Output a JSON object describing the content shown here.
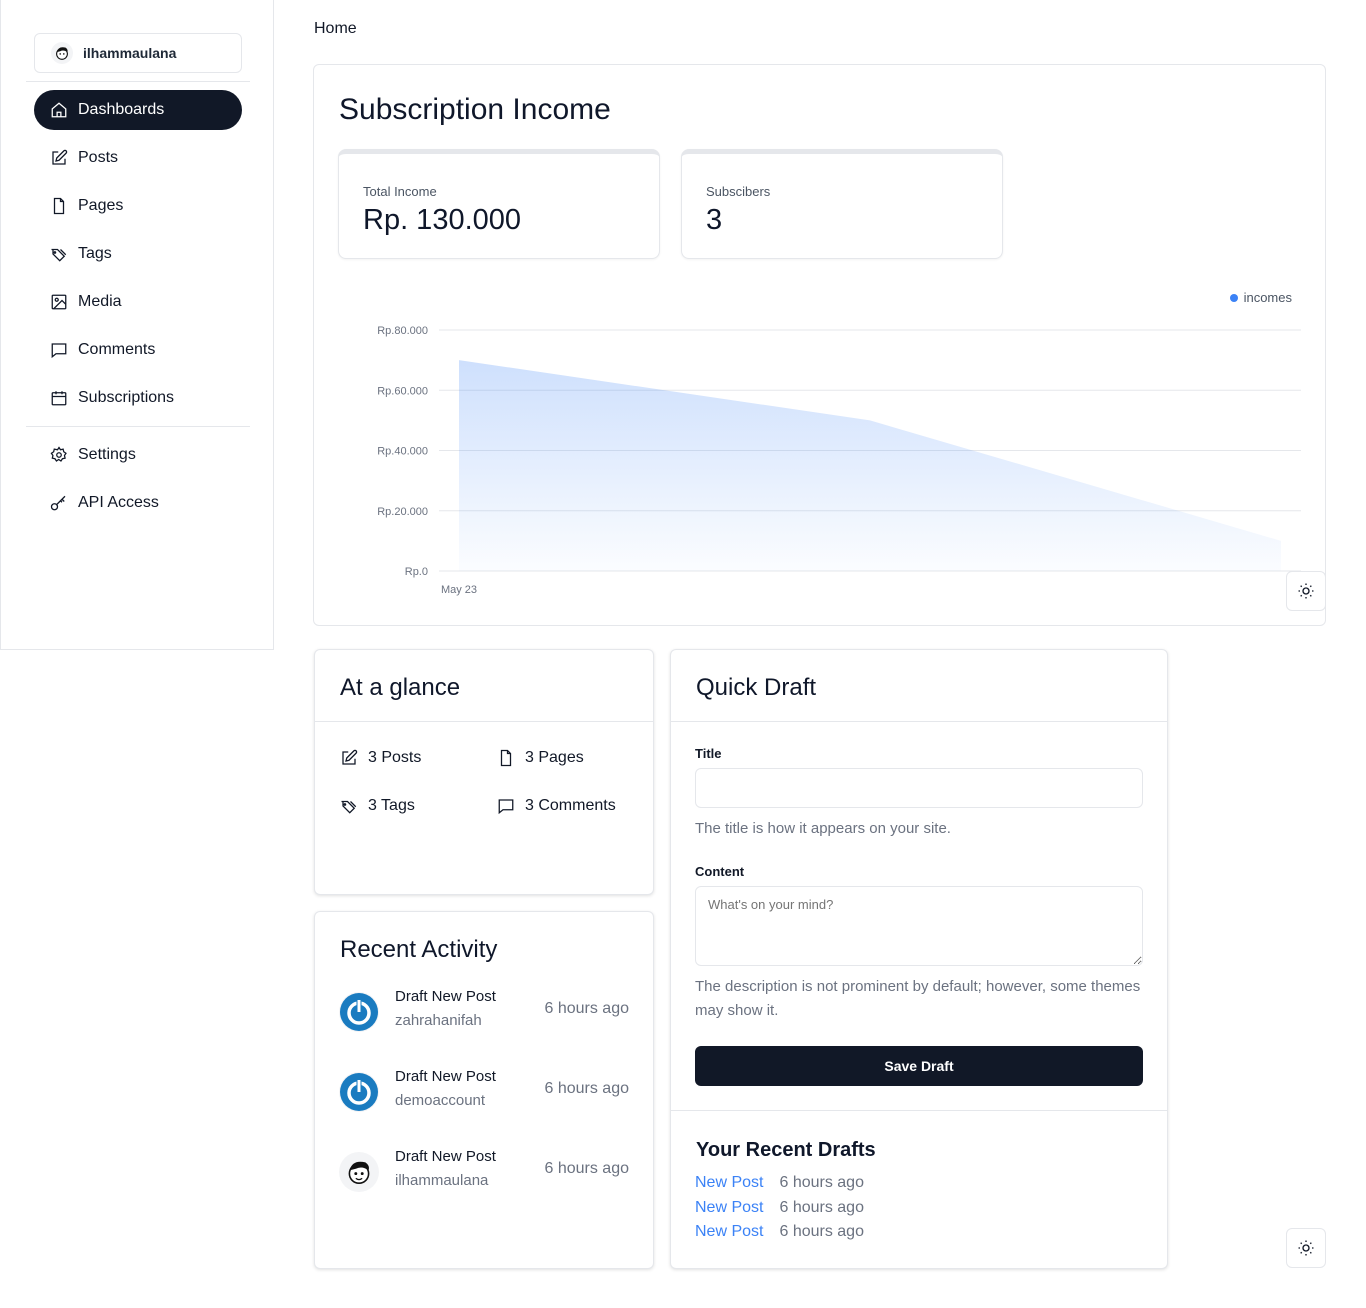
{
  "sidebar": {
    "username": "ilhammaulana",
    "items": [
      {
        "label": "Dashboards",
        "icon": "home-icon",
        "active": true
      },
      {
        "label": "Posts",
        "icon": "edit-icon"
      },
      {
        "label": "Pages",
        "icon": "file-icon"
      },
      {
        "label": "Tags",
        "icon": "tags-icon"
      },
      {
        "label": "Media",
        "icon": "image-icon"
      },
      {
        "label": "Comments",
        "icon": "comment-icon"
      },
      {
        "label": "Subscriptions",
        "icon": "calendar-icon"
      }
    ],
    "secondary": [
      {
        "label": "Settings",
        "icon": "gear-icon"
      },
      {
        "label": "API Access",
        "icon": "key-icon"
      }
    ]
  },
  "breadcrumb": "Home",
  "income": {
    "title": "Subscription Income",
    "total_label": "Total Income",
    "total_value": "Rp. 130.000",
    "subs_label": "Subscibers",
    "subs_value": "3"
  },
  "chart_data": {
    "type": "area",
    "series": [
      {
        "name": "incomes",
        "values": [
          70000,
          50000,
          10000
        ]
      }
    ],
    "x_tick_labels": [
      "May 23"
    ],
    "y_tick_labels": [
      "Rp.0",
      "Rp.20.000",
      "Rp.40.000",
      "Rp.60.000",
      "Rp.80.000"
    ],
    "ylim": [
      0,
      80000
    ],
    "legend_position": "top-right",
    "grid": true,
    "color": "#3b82f6"
  },
  "glance": {
    "title": "At a glance",
    "posts": "3 Posts",
    "pages": "3 Pages",
    "tags": "3 Tags",
    "comments": "3 Comments"
  },
  "activity": {
    "title": "Recent Activity",
    "items": [
      {
        "title": "Draft New Post",
        "user": "zahrahanifah",
        "time": "6 hours ago",
        "avatar": "power-icon"
      },
      {
        "title": "Draft New Post",
        "user": "demoaccount",
        "time": "6 hours ago",
        "avatar": "power-icon"
      },
      {
        "title": "Draft New Post",
        "user": "ilhammaulana",
        "time": "6 hours ago",
        "avatar": "user-avatar"
      }
    ]
  },
  "draft": {
    "title": "Quick Draft",
    "title_label": "Title",
    "title_value": "",
    "title_help": "The title is how it appears on your site.",
    "content_label": "Content",
    "content_placeholder": "What's on your mind?",
    "content_help": "The description is not prominent by default; however, some themes may show it.",
    "save_label": "Save Draft",
    "recent_title": "Your Recent Drafts",
    "recent": [
      {
        "name": "New Post",
        "time": "6 hours ago"
      },
      {
        "name": "New Post",
        "time": "6 hours ago"
      },
      {
        "name": "New Post",
        "time": "6 hours ago"
      }
    ]
  }
}
